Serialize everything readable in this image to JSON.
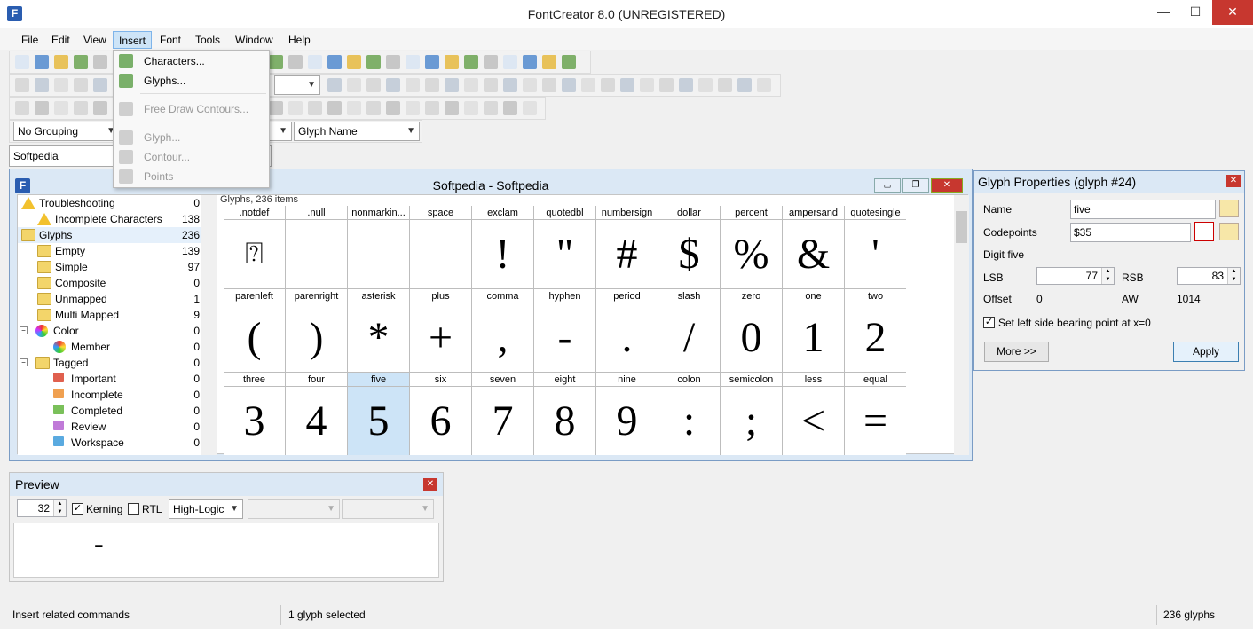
{
  "window": {
    "title": "FontCreator 8.0 (UNREGISTERED)",
    "app_icon": "F",
    "minimize": "—",
    "maximize": "☐",
    "close": "✕"
  },
  "menubar": [
    "File",
    "Edit",
    "View",
    "Insert",
    "Font",
    "Tools",
    "Window",
    "Help"
  ],
  "insert_menu": {
    "items": [
      {
        "label": "Characters...",
        "icon": "characters-icon",
        "enabled": true
      },
      {
        "label": "Glyphs...",
        "icon": "glyphs-icon",
        "enabled": true
      },
      {
        "label": "Free Draw Contours...",
        "icon": "free-draw-icon",
        "enabled": false
      },
      {
        "label": "Glyph...",
        "icon": "glyph-icon",
        "enabled": false
      },
      {
        "label": "Contour...",
        "icon": "contour-icon",
        "enabled": false
      },
      {
        "label": "Points",
        "icon": "points-icon",
        "enabled": false
      }
    ]
  },
  "toolbar": {
    "grouping": "No Grouping",
    "sort": "Glyph Name",
    "font_name": "Softpedia"
  },
  "document": {
    "title": "Softpedia - Softpedia",
    "grid_caption": "Glyphs, 236 items",
    "minimize": "▭",
    "restore": "❐",
    "close": "✕"
  },
  "tree": [
    {
      "label": "Troubleshooting",
      "count": "0",
      "icon": "warning-icon",
      "indent": 0,
      "expander": ""
    },
    {
      "label": "Incomplete Characters",
      "count": "138",
      "icon": "warning-icon",
      "indent": 1,
      "expander": ""
    },
    {
      "label": "Glyphs",
      "count": "236",
      "icon": "folder-icon",
      "indent": 0,
      "expander": "",
      "selected": true
    },
    {
      "label": "Empty",
      "count": "139",
      "icon": "folder-icon",
      "indent": 1,
      "expander": ""
    },
    {
      "label": "Simple",
      "count": "97",
      "icon": "folder-icon",
      "indent": 1,
      "expander": ""
    },
    {
      "label": "Composite",
      "count": "0",
      "icon": "folder-icon",
      "indent": 1,
      "expander": ""
    },
    {
      "label": "Unmapped",
      "count": "1",
      "icon": "folder-icon",
      "indent": 1,
      "expander": ""
    },
    {
      "label": "Multi Mapped",
      "count": "9",
      "icon": "folder-icon",
      "indent": 1,
      "expander": ""
    },
    {
      "label": "Color",
      "count": "0",
      "icon": "color-wheel-icon",
      "indent": 0,
      "expander": "−"
    },
    {
      "label": "Member",
      "count": "0",
      "icon": "color-member-icon",
      "indent": 2,
      "expander": ""
    },
    {
      "label": "Tagged",
      "count": "0",
      "icon": "folder-icon",
      "indent": 0,
      "expander": "−"
    },
    {
      "label": "Important",
      "count": "0",
      "icon": "flag-red-icon",
      "indent": 2,
      "expander": ""
    },
    {
      "label": "Incomplete",
      "count": "0",
      "icon": "flag-orange-icon",
      "indent": 2,
      "expander": ""
    },
    {
      "label": "Completed",
      "count": "0",
      "icon": "flag-green-icon",
      "indent": 2,
      "expander": ""
    },
    {
      "label": "Review",
      "count": "0",
      "icon": "flag-purple-icon",
      "indent": 2,
      "expander": ""
    },
    {
      "label": "Workspace",
      "count": "0",
      "icon": "flag-blue-icon",
      "indent": 2,
      "expander": ""
    }
  ],
  "glyphs": [
    [
      {
        "name": ".notdef",
        "glyph": "⍰"
      },
      {
        "name": ".null",
        "glyph": ""
      },
      {
        "name": "nonmarkin...",
        "glyph": ""
      },
      {
        "name": "space",
        "glyph": ""
      },
      {
        "name": "exclam",
        "glyph": "!"
      },
      {
        "name": "quotedbl",
        "glyph": "\""
      },
      {
        "name": "numbersign",
        "glyph": "#"
      },
      {
        "name": "dollar",
        "glyph": "$"
      },
      {
        "name": "percent",
        "glyph": "%"
      },
      {
        "name": "ampersand",
        "glyph": "&"
      },
      {
        "name": "quotesingle",
        "glyph": "'"
      }
    ],
    [
      {
        "name": "parenleft",
        "glyph": "("
      },
      {
        "name": "parenright",
        "glyph": ")"
      },
      {
        "name": "asterisk",
        "glyph": "*"
      },
      {
        "name": "plus",
        "glyph": "+"
      },
      {
        "name": "comma",
        "glyph": ","
      },
      {
        "name": "hyphen",
        "glyph": "-"
      },
      {
        "name": "period",
        "glyph": "."
      },
      {
        "name": "slash",
        "glyph": "/"
      },
      {
        "name": "zero",
        "glyph": "0"
      },
      {
        "name": "one",
        "glyph": "1"
      },
      {
        "name": "two",
        "glyph": "2"
      }
    ],
    [
      {
        "name": "three",
        "glyph": "3"
      },
      {
        "name": "four",
        "glyph": "4"
      },
      {
        "name": "five",
        "glyph": "5",
        "selected": true
      },
      {
        "name": "six",
        "glyph": "6"
      },
      {
        "name": "seven",
        "glyph": "7"
      },
      {
        "name": "eight",
        "glyph": "8"
      },
      {
        "name": "nine",
        "glyph": "9"
      },
      {
        "name": "colon",
        "glyph": ":"
      },
      {
        "name": "semicolon",
        "glyph": ";"
      },
      {
        "name": "less",
        "glyph": "<"
      },
      {
        "name": "equal",
        "glyph": "="
      }
    ]
  ],
  "properties": {
    "title": "Glyph Properties (glyph #24)",
    "name_label": "Name",
    "name_value": "five",
    "codepoints_label": "Codepoints",
    "codepoints_value": "$35",
    "description": "Digit five",
    "lsb_label": "LSB",
    "lsb_value": "77",
    "rsb_label": "RSB",
    "rsb_value": "83",
    "offset_label": "Offset",
    "offset_value": "0",
    "aw_label": "AW",
    "aw_value": "1014",
    "checkbox_label": "Set left side bearing point at x=0",
    "more_button": "More >>",
    "apply_button": "Apply"
  },
  "preview": {
    "title": "Preview",
    "size": "32",
    "kerning_label": "Kerning",
    "rtl_label": "RTL",
    "renderer": "High-Logic",
    "sample": "-"
  },
  "status": {
    "hint": "Insert related commands",
    "selection": "1 glyph selected",
    "count": "236 glyphs"
  },
  "colors": {
    "accent": "#cde4f7",
    "title_bg": "#dbe8f5",
    "close_red": "#c7372f"
  }
}
